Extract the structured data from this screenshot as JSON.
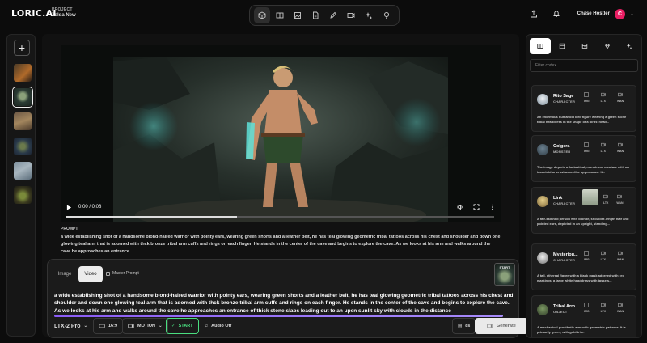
{
  "app": {
    "logo": "LORIC.AI",
    "project_label": "PROJECT",
    "project_name": "Zelda New"
  },
  "toolbar": {
    "tools": [
      "cube-icon",
      "book-icon",
      "image-icon",
      "document-icon",
      "pen-icon",
      "video-icon",
      "sparkles-icon",
      "bulb-icon"
    ],
    "active": "cube-icon"
  },
  "user": {
    "name": "Chase Hostler",
    "initial": "C",
    "avatar_color": "#e91e63"
  },
  "video": {
    "time": "0:00 / 0:08",
    "progress": 0.4
  },
  "prompt": {
    "title": "PROMPT",
    "text": "a wide establishing shot of a handsome blond-haired warrior with pointy ears, wearing green shorts and a leather belt, he has teal glowing geometric tribal tattoos across his chest and shoulder and down one glowing teal arm that is adorned with thck bronze tribal arm cuffs and rings on each finger. He stands in the center of the cave and begins to explore the cave. As we looks at his arm and walks around the cave he approaches an entrance"
  },
  "composer": {
    "tabs": [
      "Image",
      "Video"
    ],
    "active_tab": "Video",
    "master_prompt": "Master Prompt",
    "start_label": "START",
    "text": "a wide establishing shot of a handsome blond-haired warrior with pointy ears, wearing green shorts and a leather belt, he has teal glowing geometric tribal tattoos across his chest and shoulder and down one glowing teal arm that is adorned with thck bronze tribal arm cuffs and rings on each finger. He stands in the center of the cave and begins to explore the cave. As we looks at his arm and walks around the cave he approaches an entrance of thick stone slabs leading out to an upen sunlit sky with clouds in the distance",
    "model": "LTX-2 Pro",
    "aspect": "16:9",
    "motion": "MOTION",
    "start_btn": "START",
    "audio": "Audio Off",
    "duration": "8s",
    "generate": "Generate"
  },
  "codex": {
    "filter_placeholder": "Filter codex...",
    "icon_labels": [
      "IMG",
      "LTX",
      "WAN"
    ],
    "items": [
      {
        "name": "Rito Sage",
        "type": "CHARACTER",
        "desc": "An enormous humanoid bird figure wearing a green stone tribal headdress in the shape of a birds' head..."
      },
      {
        "name": "Colgera",
        "type": "MONSTER",
        "desc": "The image depicts a fantastical, monstrous creature with an insectoid or crustacean-like appearance. It..."
      },
      {
        "name": "Link",
        "type": "CHARACTER",
        "desc": "A fair-skinned person with blonde, shoulder-length hair and pointed ears, depicted in an upright, standing..."
      },
      {
        "name": "Mysteriou...",
        "type": "CHARACTER",
        "desc": "A tall, ethereal figure with a black mask adorned with red markings, a large white headdress with tassels..."
      },
      {
        "name": "Tribal Arm",
        "type": "OBJECT",
        "desc": "A mechanical prosthetic arm with geometric patterns. It is primarily green, with gold trim."
      }
    ]
  }
}
